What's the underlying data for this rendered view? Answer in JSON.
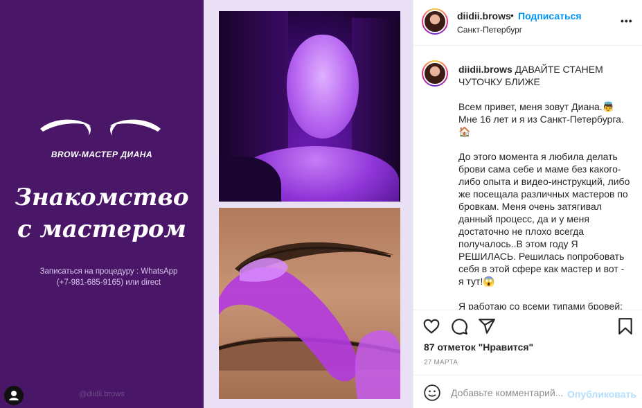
{
  "media": {
    "brand": "BROW-МАСТЕР ДИАНА",
    "headline_line1": "Знакомство",
    "headline_line2": "с мастером",
    "booking_line1": "Записаться на процедуру : WhatsApp",
    "booking_line2": "(+7-981-685-9165) или direct",
    "watermark": "@diidii.brows",
    "colors": {
      "purple_panel": "#4a1668",
      "light_panel": "#e9e0f5"
    }
  },
  "post_header": {
    "username": "diidii.brows",
    "separator": "•",
    "follow_label": "Подписаться",
    "location": "Санкт-Петербург",
    "more_icon": "more-icon"
  },
  "caption": {
    "username": "diidii.brows",
    "title": "ДАВАЙТЕ СТАНЕМ ЧУТОЧКУ БЛИЖЕ",
    "para1": "Всем привет, меня зовут Диана.👼 Мне 16 лет и я из Санкт-Петербурга. 🏠",
    "para2": "До этого момента я любила делать брови сама себе и маме без какого-либо опыта и видео-инструкций, либо же посещала различных мастеров по бровкам. Меня очень затягивал данный процесс, да и у меня достаточно не плохо всегда получалось..В этом году Я РЕШИЛАСЬ. Решилась попробовать себя в этой сфере как мастер и вот - я тут!😱",
    "para3": "Я работаю со всеми типами бровей:"
  },
  "actions": {
    "like_icon": "heart-icon",
    "comment_icon": "comment-icon",
    "share_icon": "share-icon",
    "save_icon": "bookmark-icon",
    "likes": "87 отметок \"Нравится\"",
    "date": "27 МАРТА"
  },
  "comment_bar": {
    "emoji_icon": "emoji-icon",
    "placeholder": "Добавьте комментарий...",
    "publish_label": "Опубликовать"
  }
}
